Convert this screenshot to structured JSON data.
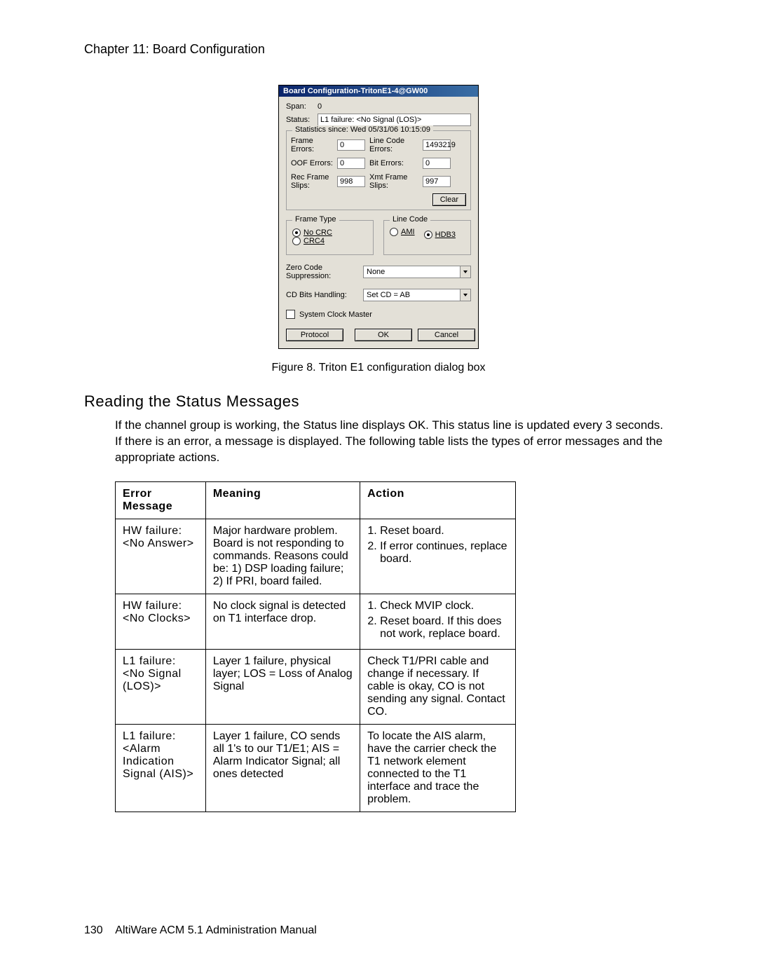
{
  "chapter_header": "Chapter 11:  Board Configuration",
  "dialog": {
    "title": "Board Configuration-TritonE1-4@GW00",
    "span_label": "Span:",
    "span_value": "0",
    "status_label": "Status:",
    "status_value": "L1 failure: <No Signal (LOS)>",
    "stats_legend": "Statistics since: Wed 05/31/06 10:15:09",
    "stats": {
      "frame_errors_label": "Frame Errors:",
      "frame_errors": "0",
      "line_code_errors_label": "Line Code Errors:",
      "line_code_errors": "1493219",
      "oof_errors_label": "OOF Errors:",
      "oof_errors": "0",
      "bit_errors_label": "Bit Errors:",
      "bit_errors": "0",
      "rec_frame_slips_label": "Rec Frame Slips:",
      "rec_frame_slips": "998",
      "xmt_frame_slips_label": "Xmt Frame Slips:",
      "xmt_frame_slips": "997"
    },
    "clear_btn": "Clear",
    "frame_type_legend": "Frame Type",
    "frame_type_opts": {
      "nocrc": "No CRC",
      "crc4": "CRC4"
    },
    "line_code_legend": "Line Code",
    "line_code_opts": {
      "ami": "AMI",
      "hdb3": "HDB3"
    },
    "zero_label": "Zero Code Suppression:",
    "zero_value": "None",
    "cd_label": "CD Bits Handling:",
    "cd_value": "Set CD = AB",
    "sysclock_label": "System Clock Master",
    "btn_protocol": "Protocol",
    "btn_ok": "OK",
    "btn_cancel": "Cancel"
  },
  "figure_caption": "Figure 8.   Triton E1 configuration dialog box",
  "section_heading": "Reading the Status Messages",
  "section_body": "If the channel group is working, the Status line displays OK. This status line is updated every 3 seconds. If there is an error, a message is displayed. The following table lists the types of error messages and the appropriate actions.",
  "table": {
    "headers": {
      "err": "Error Message",
      "meaning": "Meaning",
      "action": "Action"
    },
    "rows": [
      {
        "err": "HW failure: <No Answer>",
        "meaning": "Major hardware problem. Board is not responding to commands. Reasons could be: 1) DSP loading failure; 2) If PRI, board failed.",
        "actions": [
          "Reset board.",
          "If error continues, replace board."
        ]
      },
      {
        "err": "HW failure: <No Clocks>",
        "meaning": "No clock signal is detected on T1 interface drop.",
        "actions": [
          "Check MVIP clock.",
          "Reset board. If this does not work, replace board."
        ]
      },
      {
        "err": "L1 failure: <No Signal (LOS)>",
        "meaning": "Layer 1 failure, physical layer; LOS = Loss of Analog Signal",
        "action_text": "Check T1/PRI cable and change if necessary. If cable is okay, CO is not sending any signal. Contact CO."
      },
      {
        "err": "L1 failure: <Alarm Indication Signal (AIS)>",
        "meaning": "Layer 1 failure, CO sends all 1's to our T1/E1; AIS = Alarm Indicator Signal; all ones detected",
        "action_text": "To locate the AIS alarm, have the carrier check the T1 network element connected to the T1 interface and trace the problem."
      }
    ]
  },
  "footer": {
    "page": "130",
    "manual": "AltiWare ACM 5.1 Administration Manual"
  }
}
